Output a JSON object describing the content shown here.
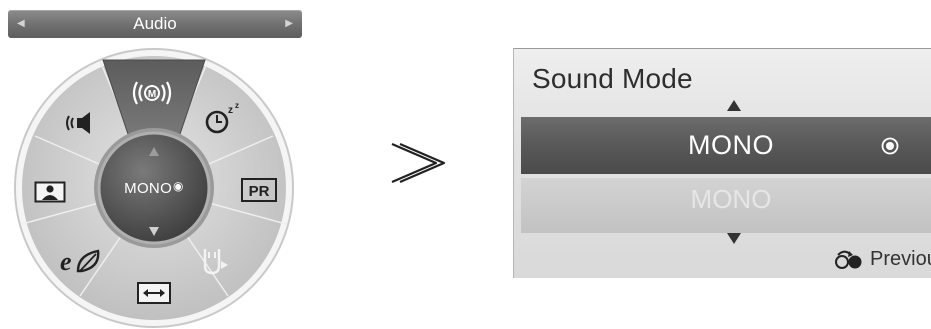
{
  "quick_menu": {
    "title": "Audio",
    "center_value": "MONO",
    "center_mark": "◉",
    "items": [
      {
        "name": "sound-mode",
        "icon": "audio-wave-m-icon"
      },
      {
        "name": "sleep-timer",
        "icon": "sleep-timer-icon"
      },
      {
        "name": "pr",
        "icon": "pr-icon",
        "label": "PR"
      },
      {
        "name": "usb",
        "icon": "usb-device-icon"
      },
      {
        "name": "aspect-ratio",
        "icon": "aspect-ratio-icon"
      },
      {
        "name": "energy-saving",
        "icon": "eco-icon"
      },
      {
        "name": "picture",
        "icon": "picture-icon"
      },
      {
        "name": "speaker",
        "icon": "speaker-icon"
      }
    ]
  },
  "transition_symbol": "≫",
  "sound_mode_dialog": {
    "title": "Sound Mode",
    "selected_value": "MONO",
    "next_value": "MONO",
    "previous_label": "Previous"
  },
  "colors": {
    "wheel_outer": "#d6d6d6",
    "wheel_segment_active": "#6e6e6e",
    "wheel_center": "#5a5a5a",
    "selected_row": "#5a5a5a"
  }
}
